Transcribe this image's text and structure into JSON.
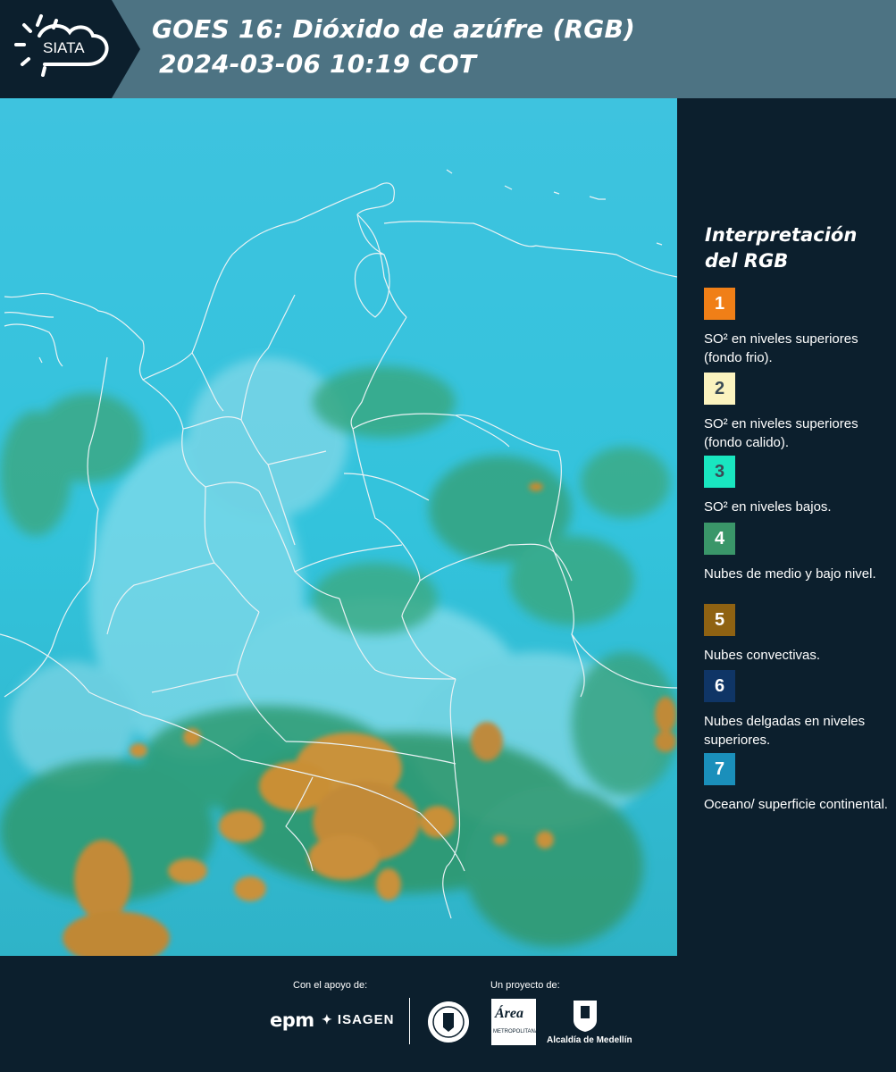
{
  "header": {
    "title_line1": "GOES 16: Dióxido de azúfre (RGB)",
    "title_line2": "2024-03-06 10:19 COT",
    "logo_text": "SIATA"
  },
  "map": {
    "background_color": "#2db8d6",
    "border_color": "#e8f0f2"
  },
  "legend": {
    "title": "Interpretación del RGB",
    "items": [
      {
        "number": "1",
        "color": "#f07f17",
        "text": "SO² en niveles superiores (fondo frio)."
      },
      {
        "number": "2",
        "color": "#fbf3bf",
        "text": "SO² en niveles superiores (fondo calido)."
      },
      {
        "number": "3",
        "color": "#19e6c0",
        "text": "SO² en niveles bajos."
      },
      {
        "number": "4",
        "color": "#3a9669",
        "text": "Nubes de medio y bajo nivel."
      },
      {
        "number": "5",
        "color": "#8f6212",
        "text": "Nubes convectivas."
      },
      {
        "number": "6",
        "color": "#0f3566",
        "text": "Nubes delgadas en niveles superiores."
      },
      {
        "number": "7",
        "color": "#1a8fbb",
        "text": "Oceano/ superficie continental."
      }
    ]
  },
  "footer": {
    "support_label": "Con el apoyo de:",
    "project_label": "Un proyecto de:",
    "support_logos": [
      "epm",
      "ISAGEN"
    ],
    "project_logos": [
      "Área Metropolitana Valle de Aburrá",
      "Alcaldía de Medellín"
    ],
    "epm_text": "epm",
    "isagen_text": "ISAGEN",
    "area_text": "Área",
    "area_subtext": "METROPOLITANA",
    "alcaldia_text": "Alcaldía de Medellín"
  }
}
